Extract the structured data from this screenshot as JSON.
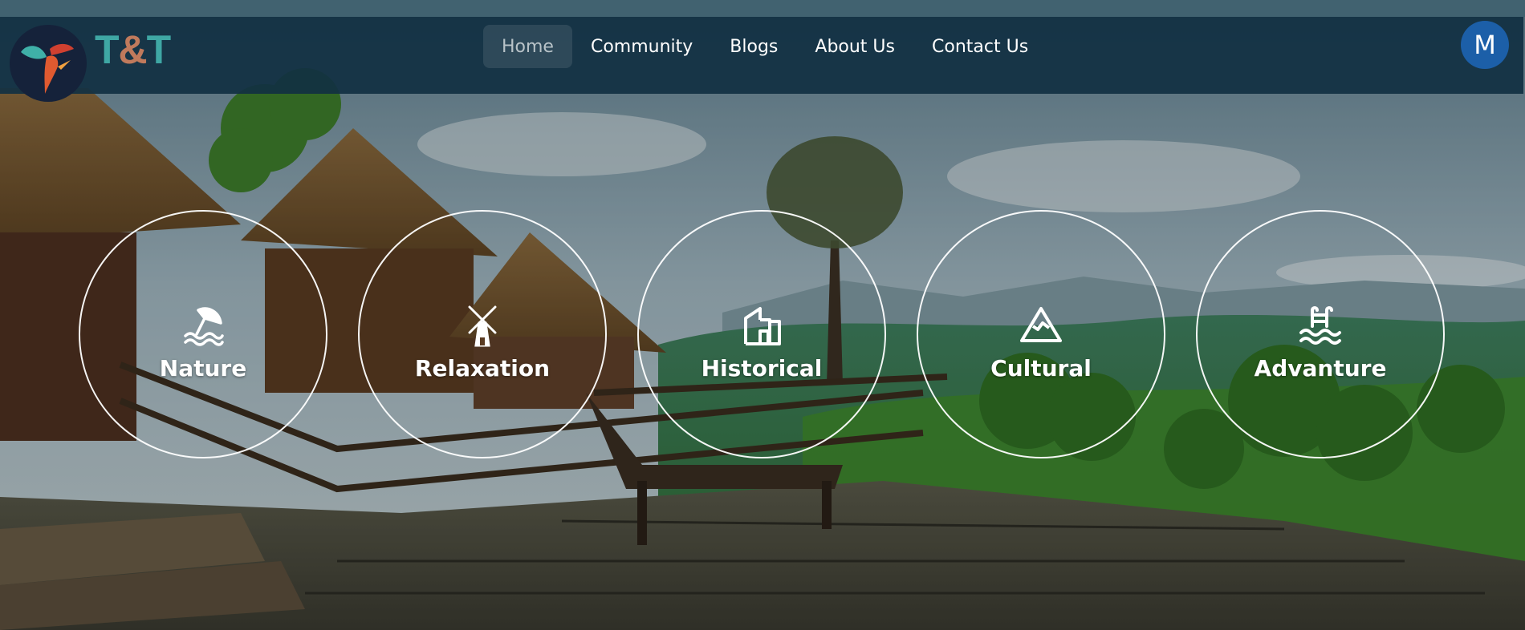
{
  "navbar": {
    "brand": {
      "part1": "T",
      "part2": "&",
      "part3": "T"
    },
    "links": [
      {
        "label": "Home",
        "active": true
      },
      {
        "label": "Community",
        "active": false
      },
      {
        "label": "Blogs",
        "active": false
      },
      {
        "label": "About Us",
        "active": false
      },
      {
        "label": "Contact Us",
        "active": false
      }
    ],
    "avatar_initial": "M"
  },
  "categories": [
    {
      "label": "Nature",
      "icon": "beach-umbrella-icon"
    },
    {
      "label": "Relaxation",
      "icon": "windmill-icon"
    },
    {
      "label": "Historical",
      "icon": "building-icon"
    },
    {
      "label": "Cultural",
      "icon": "mountain-icon"
    },
    {
      "label": "Advanture",
      "icon": "swimming-pool-icon"
    }
  ],
  "colors": {
    "navbar_bg": "#113042",
    "top_strip": "#416270",
    "brand_teal": "#3fa7a4",
    "brand_terracotta": "#c07a5c",
    "avatar_bg": "#1c5fa8",
    "circle_border": "#ffffff"
  }
}
